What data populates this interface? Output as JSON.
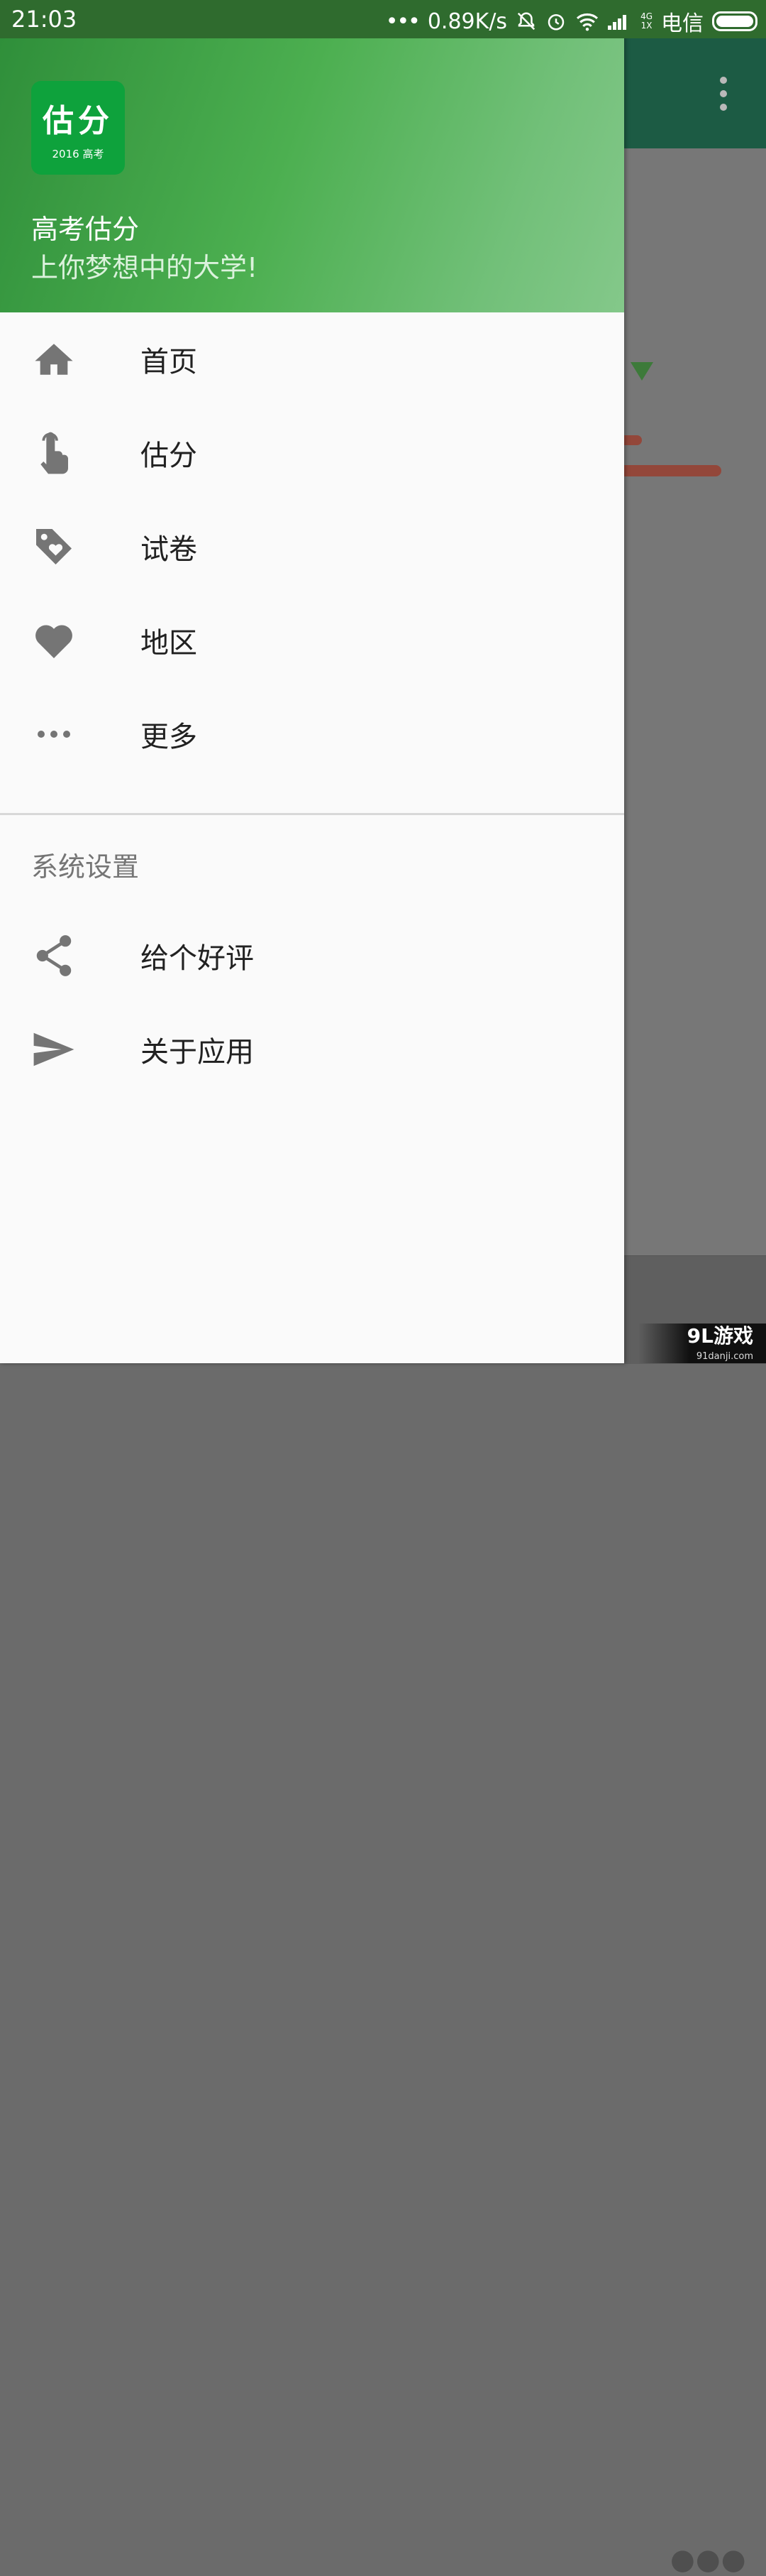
{
  "status_bar": {
    "time": "21:03",
    "network_speed": "0.89K/s",
    "network_type_top": "4G",
    "network_type_bottom": "1X",
    "carrier": "电信"
  },
  "drawer": {
    "logo": {
      "main_text": "估分",
      "sub_text": "2016 高考"
    },
    "title": "高考估分",
    "subtitle": "上你梦想中的大学!",
    "items": [
      {
        "label": "首页",
        "icon": "home-icon"
      },
      {
        "label": "估分",
        "icon": "touch-icon"
      },
      {
        "label": "试卷",
        "icon": "tag-heart-icon"
      },
      {
        "label": "地区",
        "icon": "heart-icon"
      },
      {
        "label": "更多",
        "icon": "more-horiz-icon"
      }
    ],
    "section_title": "系统设置",
    "settings_items": [
      {
        "label": "给个好评",
        "icon": "share-icon"
      },
      {
        "label": "关于应用",
        "icon": "send-icon"
      }
    ]
  },
  "watermark": {
    "main": "9L游戏",
    "sub": "91danji.com"
  },
  "colors": {
    "header_start": "#2f8f3a",
    "header_end": "#84c88a",
    "toolbar": "#1c5b44",
    "icon_gray": "#757575"
  }
}
